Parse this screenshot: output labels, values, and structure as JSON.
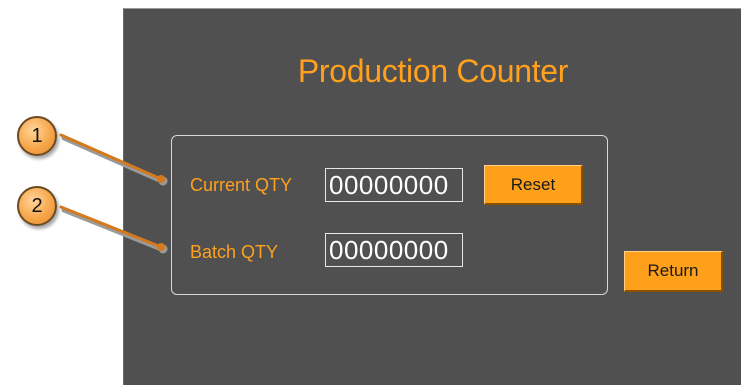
{
  "screen": {
    "title": "Production Counter"
  },
  "fields": [
    {
      "label": "Current QTY",
      "value": "00000000"
    },
    {
      "label": "Batch QTY",
      "value": "00000000"
    }
  ],
  "buttons": {
    "reset_label": "Reset",
    "return_label": "Return"
  },
  "callouts": [
    "1",
    "2"
  ],
  "colors": {
    "panel_bg": "#505050",
    "accent": "#ffa01e",
    "button_bg": "#ffa01a",
    "value_text": "#ffffff"
  }
}
